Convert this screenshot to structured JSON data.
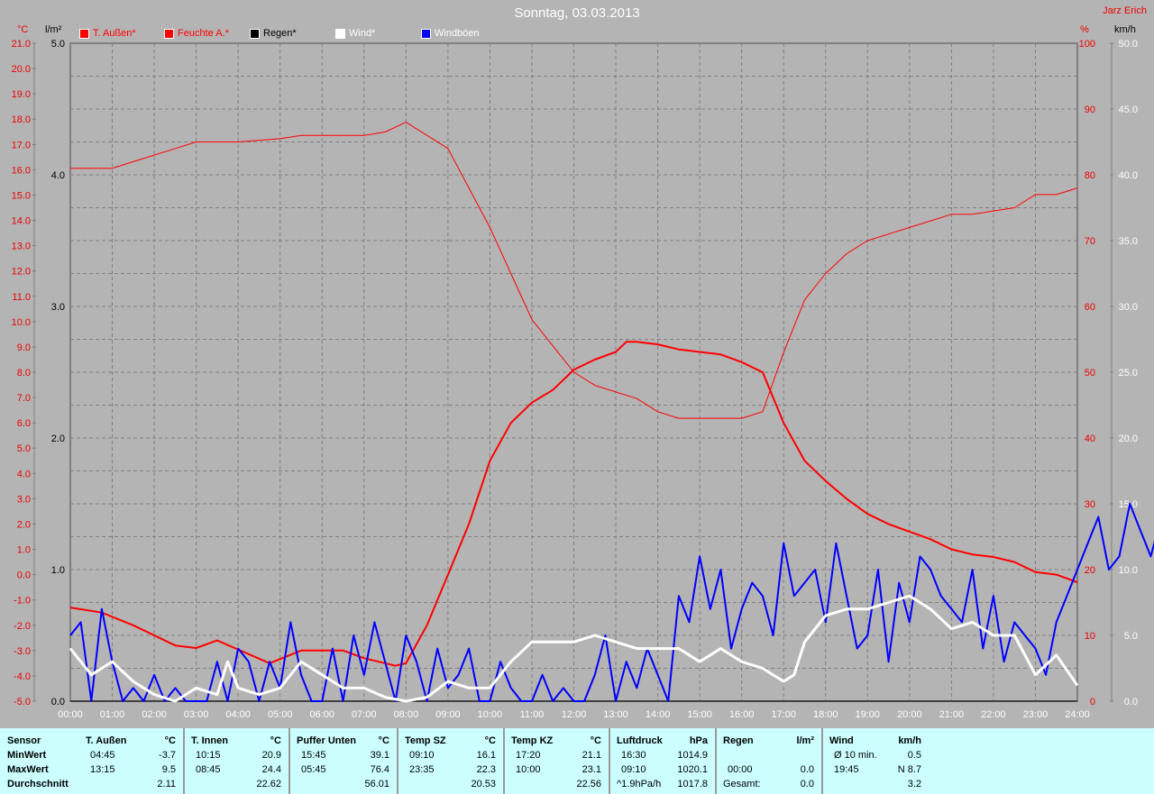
{
  "header": {
    "title": "Sonntag, 03.03.2013",
    "author": "Jarz Erich"
  },
  "units": {
    "temp": "°C",
    "rain": "l/m²",
    "hum": "%",
    "wind": "km/h"
  },
  "legend": [
    {
      "label": "T. Außen*",
      "color": "#ff0000",
      "text_color": "#ff0000"
    },
    {
      "label": "Feuchte A.*",
      "color": "#ff0000",
      "text_color": "#ff0000"
    },
    {
      "label": "Regen*",
      "color": "#000000",
      "text_color": "#000000"
    },
    {
      "label": "Wind*",
      "color": "#ffffff",
      "text_color": "#ffffff"
    },
    {
      "label": "Windböen",
      "color": "#0000ff",
      "text_color": "#ffffff"
    }
  ],
  "chart_data": {
    "type": "line",
    "title": "Sonntag, 03.03.2013",
    "x_ticks": [
      "00:00",
      "01:00",
      "02:00",
      "03:00",
      "04:00",
      "05:00",
      "06:00",
      "07:00",
      "08:00",
      "09:00",
      "10:00",
      "11:00",
      "12:00",
      "13:00",
      "14:00",
      "15:00",
      "16:00",
      "17:00",
      "18:00",
      "19:00",
      "20:00",
      "21:00",
      "22:00",
      "23:00",
      "24:00"
    ],
    "axes": {
      "temp": {
        "range": [
          -5,
          21
        ],
        "ticks": [
          "21.0",
          "20.0",
          "19.0",
          "18.0",
          "17.0",
          "16.0",
          "15.0",
          "14.0",
          "13.0",
          "12.0",
          "11.0",
          "10.0",
          "9.0",
          "8.0",
          "7.0",
          "6.0",
          "5.0",
          "4.0",
          "3.0",
          "2.0",
          "1.0",
          "0.0",
          "-1.0",
          "-2.0",
          "-3.0",
          "-4.0",
          "-5.0"
        ]
      },
      "rain": {
        "range": [
          0,
          5
        ],
        "ticks": [
          "5.0",
          "4.0",
          "3.0",
          "2.0",
          "1.0",
          "0.0"
        ]
      },
      "hum": {
        "range": [
          0,
          100
        ],
        "ticks": [
          "100",
          "90",
          "80",
          "70",
          "60",
          "50",
          "40",
          "30",
          "20",
          "10",
          "0"
        ]
      },
      "wind": {
        "range": [
          0,
          50
        ],
        "ticks": [
          "50.0",
          "45.0",
          "40.0",
          "35.0",
          "30.0",
          "25.0",
          "20.0",
          "15.0",
          "10.0",
          "5.0",
          "0.0"
        ]
      }
    },
    "series": [
      {
        "name": "T. Außen",
        "axis": "temp",
        "color": "#ff0000",
        "width": 2,
        "x": [
          0,
          0.75,
          1.5,
          2.5,
          3,
          3.5,
          4.75,
          5.5,
          6.5,
          7,
          7.75,
          8,
          8.5,
          9,
          9.5,
          10,
          10.5,
          11,
          11.5,
          12,
          12.5,
          13,
          13.25,
          13.5,
          14,
          14.5,
          15,
          15.5,
          16,
          16.5,
          17,
          17.5,
          18,
          18.5,
          19,
          19.5,
          20,
          20.5,
          21,
          21.5,
          22,
          22.5,
          23,
          23.5,
          24
        ],
        "y": [
          -1.3,
          -1.5,
          -2.0,
          -2.8,
          -2.9,
          -2.6,
          -3.5,
          -3.0,
          -3.0,
          -3.3,
          -3.6,
          -3.5,
          -2.0,
          0.0,
          2.0,
          4.5,
          6.0,
          6.8,
          7.3,
          8.1,
          8.5,
          8.8,
          9.2,
          9.2,
          9.1,
          8.9,
          8.8,
          8.7,
          8.4,
          8.0,
          6.0,
          4.5,
          3.7,
          3.0,
          2.4,
          2.0,
          1.7,
          1.4,
          1.0,
          0.8,
          0.7,
          0.5,
          0.1,
          0.0,
          -0.3
        ]
      },
      {
        "name": "Feuchte A.",
        "axis": "hum",
        "color": "#ff0000",
        "width": 1,
        "x": [
          0,
          1,
          1.5,
          2,
          2.5,
          3,
          4,
          5,
          5.5,
          7,
          7.5,
          8,
          8.5,
          9,
          9.5,
          10,
          10.5,
          11,
          11.5,
          12,
          12.5,
          13,
          13.5,
          14,
          14.5,
          15,
          16,
          16.5,
          17,
          17.5,
          18,
          18.5,
          19,
          19.5,
          20,
          20.5,
          21,
          21.5,
          22,
          22.5,
          23,
          23.5,
          24
        ],
        "y": [
          81,
          81,
          82,
          83,
          84,
          85,
          85,
          85.5,
          86,
          86,
          86.5,
          88,
          86,
          84,
          78,
          72,
          65,
          58,
          54,
          50,
          48,
          47,
          46,
          44,
          43,
          43,
          43,
          44,
          53,
          61,
          65,
          68,
          70,
          71,
          72,
          73,
          74,
          74,
          74.5,
          75,
          77,
          77,
          78
        ]
      },
      {
        "name": "Regen",
        "axis": "rain",
        "color": "#000000",
        "width": 1,
        "x": [
          0,
          24
        ],
        "y": [
          0,
          0
        ]
      },
      {
        "name": "Windböen",
        "axis": "wind",
        "color": "#0000ff",
        "width": 2,
        "x_step_hours": 0.25,
        "y": [
          5,
          6,
          0,
          7,
          3,
          0,
          1,
          0,
          2,
          0,
          1,
          0,
          0,
          0,
          3,
          0,
          4,
          3,
          0,
          3,
          1,
          6,
          2,
          0,
          0,
          4,
          0,
          5,
          2,
          6,
          3,
          0,
          5,
          3,
          0,
          4,
          1,
          2,
          4,
          0,
          0,
          3,
          1,
          0,
          0,
          2,
          0,
          1,
          0,
          0,
          2,
          5,
          0,
          3,
          1,
          4,
          2,
          0,
          8,
          6,
          11,
          7,
          10,
          4,
          7,
          9,
          8,
          5,
          12,
          8,
          9,
          10,
          6,
          12,
          8,
          4,
          5,
          10,
          3,
          9,
          6,
          11,
          10,
          8,
          7,
          6,
          10,
          4,
          8,
          3,
          6,
          5,
          4,
          2,
          6,
          8,
          10,
          12,
          14,
          10,
          11,
          15,
          13,
          11,
          14,
          12,
          15,
          13,
          11,
          16,
          12,
          10,
          13,
          12,
          7,
          11,
          8,
          13,
          9,
          11,
          4,
          9,
          12,
          6,
          0,
          3,
          9,
          6,
          0,
          3
        ],
        "note": "approximate"
      },
      {
        "name": "Wind",
        "axis": "wind",
        "color": "#ffffff",
        "width": 3,
        "x": [
          0,
          0.5,
          1,
          1.5,
          2,
          2.5,
          3,
          3.5,
          3.75,
          4,
          4.5,
          5,
          5.5,
          6,
          6.5,
          7,
          7.5,
          8,
          8.5,
          9,
          9.5,
          10,
          10.5,
          11,
          11.5,
          12,
          12.5,
          13,
          13.5,
          14,
          14.5,
          15,
          15.5,
          16,
          16.5,
          17,
          17.25,
          17.5,
          18,
          18.5,
          19,
          19.5,
          20,
          20.5,
          21,
          21.5,
          22,
          22.5,
          23,
          23.5,
          24
        ],
        "y": [
          4,
          2,
          3,
          1.5,
          0.5,
          0,
          1,
          0.5,
          3,
          1,
          0.5,
          1,
          3,
          2,
          1,
          1,
          0.3,
          0,
          0.3,
          1.5,
          1,
          1,
          3,
          4.5,
          4.5,
          4.5,
          5,
          4.5,
          4,
          4,
          4,
          3,
          4,
          3,
          2.5,
          1.5,
          2,
          4.5,
          6.5,
          7,
          7,
          7.5,
          8,
          7,
          5.5,
          6,
          5,
          5,
          2,
          3.5,
          1.2
        ]
      }
    ]
  },
  "table": {
    "columns": [
      {
        "header": "Sensor",
        "unit": "",
        "rows": [
          [
            "MinWert",
            ""
          ],
          [
            "MaxWert",
            ""
          ],
          [
            "Durchschnitt",
            ""
          ]
        ]
      },
      {
        "header": "T. Außen",
        "unit": "°C",
        "rows": [
          [
            "04:45",
            "-3.7"
          ],
          [
            "13:15",
            "9.5"
          ],
          [
            "",
            "2.11"
          ]
        ]
      },
      {
        "header": "T. Innen",
        "unit": "°C",
        "rows": [
          [
            "10:15",
            "20.9"
          ],
          [
            "08:45",
            "24.4"
          ],
          [
            "",
            "22.62"
          ]
        ]
      },
      {
        "header": "Puffer Unten",
        "unit": "°C",
        "rows": [
          [
            "15:45",
            "39.1"
          ],
          [
            "05:45",
            "76.4"
          ],
          [
            "",
            "56.01"
          ]
        ]
      },
      {
        "header": "Temp SZ",
        "unit": "°C",
        "rows": [
          [
            "09:10",
            "16.1"
          ],
          [
            "23:35",
            "22.3"
          ],
          [
            "",
            "20.53"
          ]
        ]
      },
      {
        "header": "Temp KZ",
        "unit": "°C",
        "rows": [
          [
            "17:20",
            "21.1"
          ],
          [
            "10:00",
            "23.1"
          ],
          [
            "",
            "22.56"
          ]
        ]
      },
      {
        "header": "Luftdruck",
        "unit": "hPa",
        "rows": [
          [
            "16:30",
            "1014.9"
          ],
          [
            "09:10",
            "1020.1"
          ],
          [
            "^1.9hPa/h",
            "1017.8"
          ]
        ]
      },
      {
        "header": "Regen",
        "unit": "l/m²",
        "rows": [
          [
            "",
            ""
          ],
          [
            "00:00",
            "0.0"
          ],
          [
            "Gesamt:",
            "0.0"
          ]
        ]
      },
      {
        "header": "Wind",
        "unit": "km/h",
        "rows": [
          [
            "Ø 10 min.",
            "0.5"
          ],
          [
            "19:45",
            "N 8.7"
          ],
          [
            "",
            "3.2"
          ]
        ]
      }
    ]
  }
}
